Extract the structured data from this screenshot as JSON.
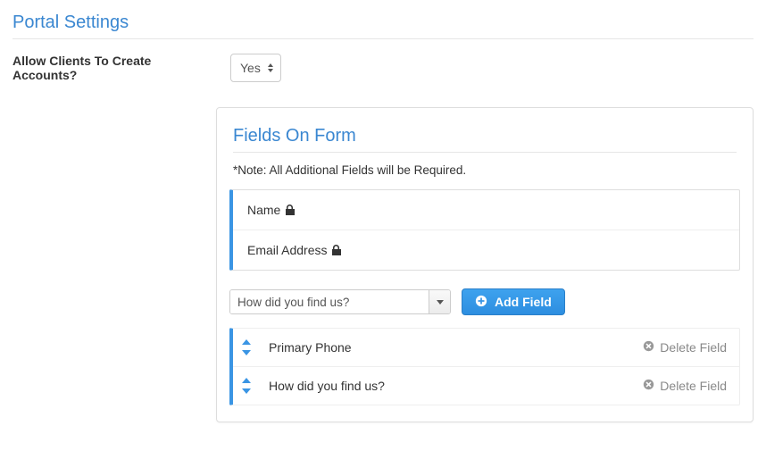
{
  "header": {
    "title": "Portal Settings"
  },
  "setting": {
    "label": "Allow Clients To Create Accounts?",
    "value": "Yes"
  },
  "panel": {
    "title": "Fields On Form",
    "note": "*Note: All Additional Fields will be Required.",
    "locked_fields": [
      {
        "label": "Name"
      },
      {
        "label": "Email Address"
      }
    ],
    "combo_value": "How did you find us?",
    "add_button": "Add Field",
    "delete_label": "Delete Field",
    "custom_fields": [
      {
        "label": "Primary Phone"
      },
      {
        "label": "How did you find us?"
      }
    ]
  }
}
